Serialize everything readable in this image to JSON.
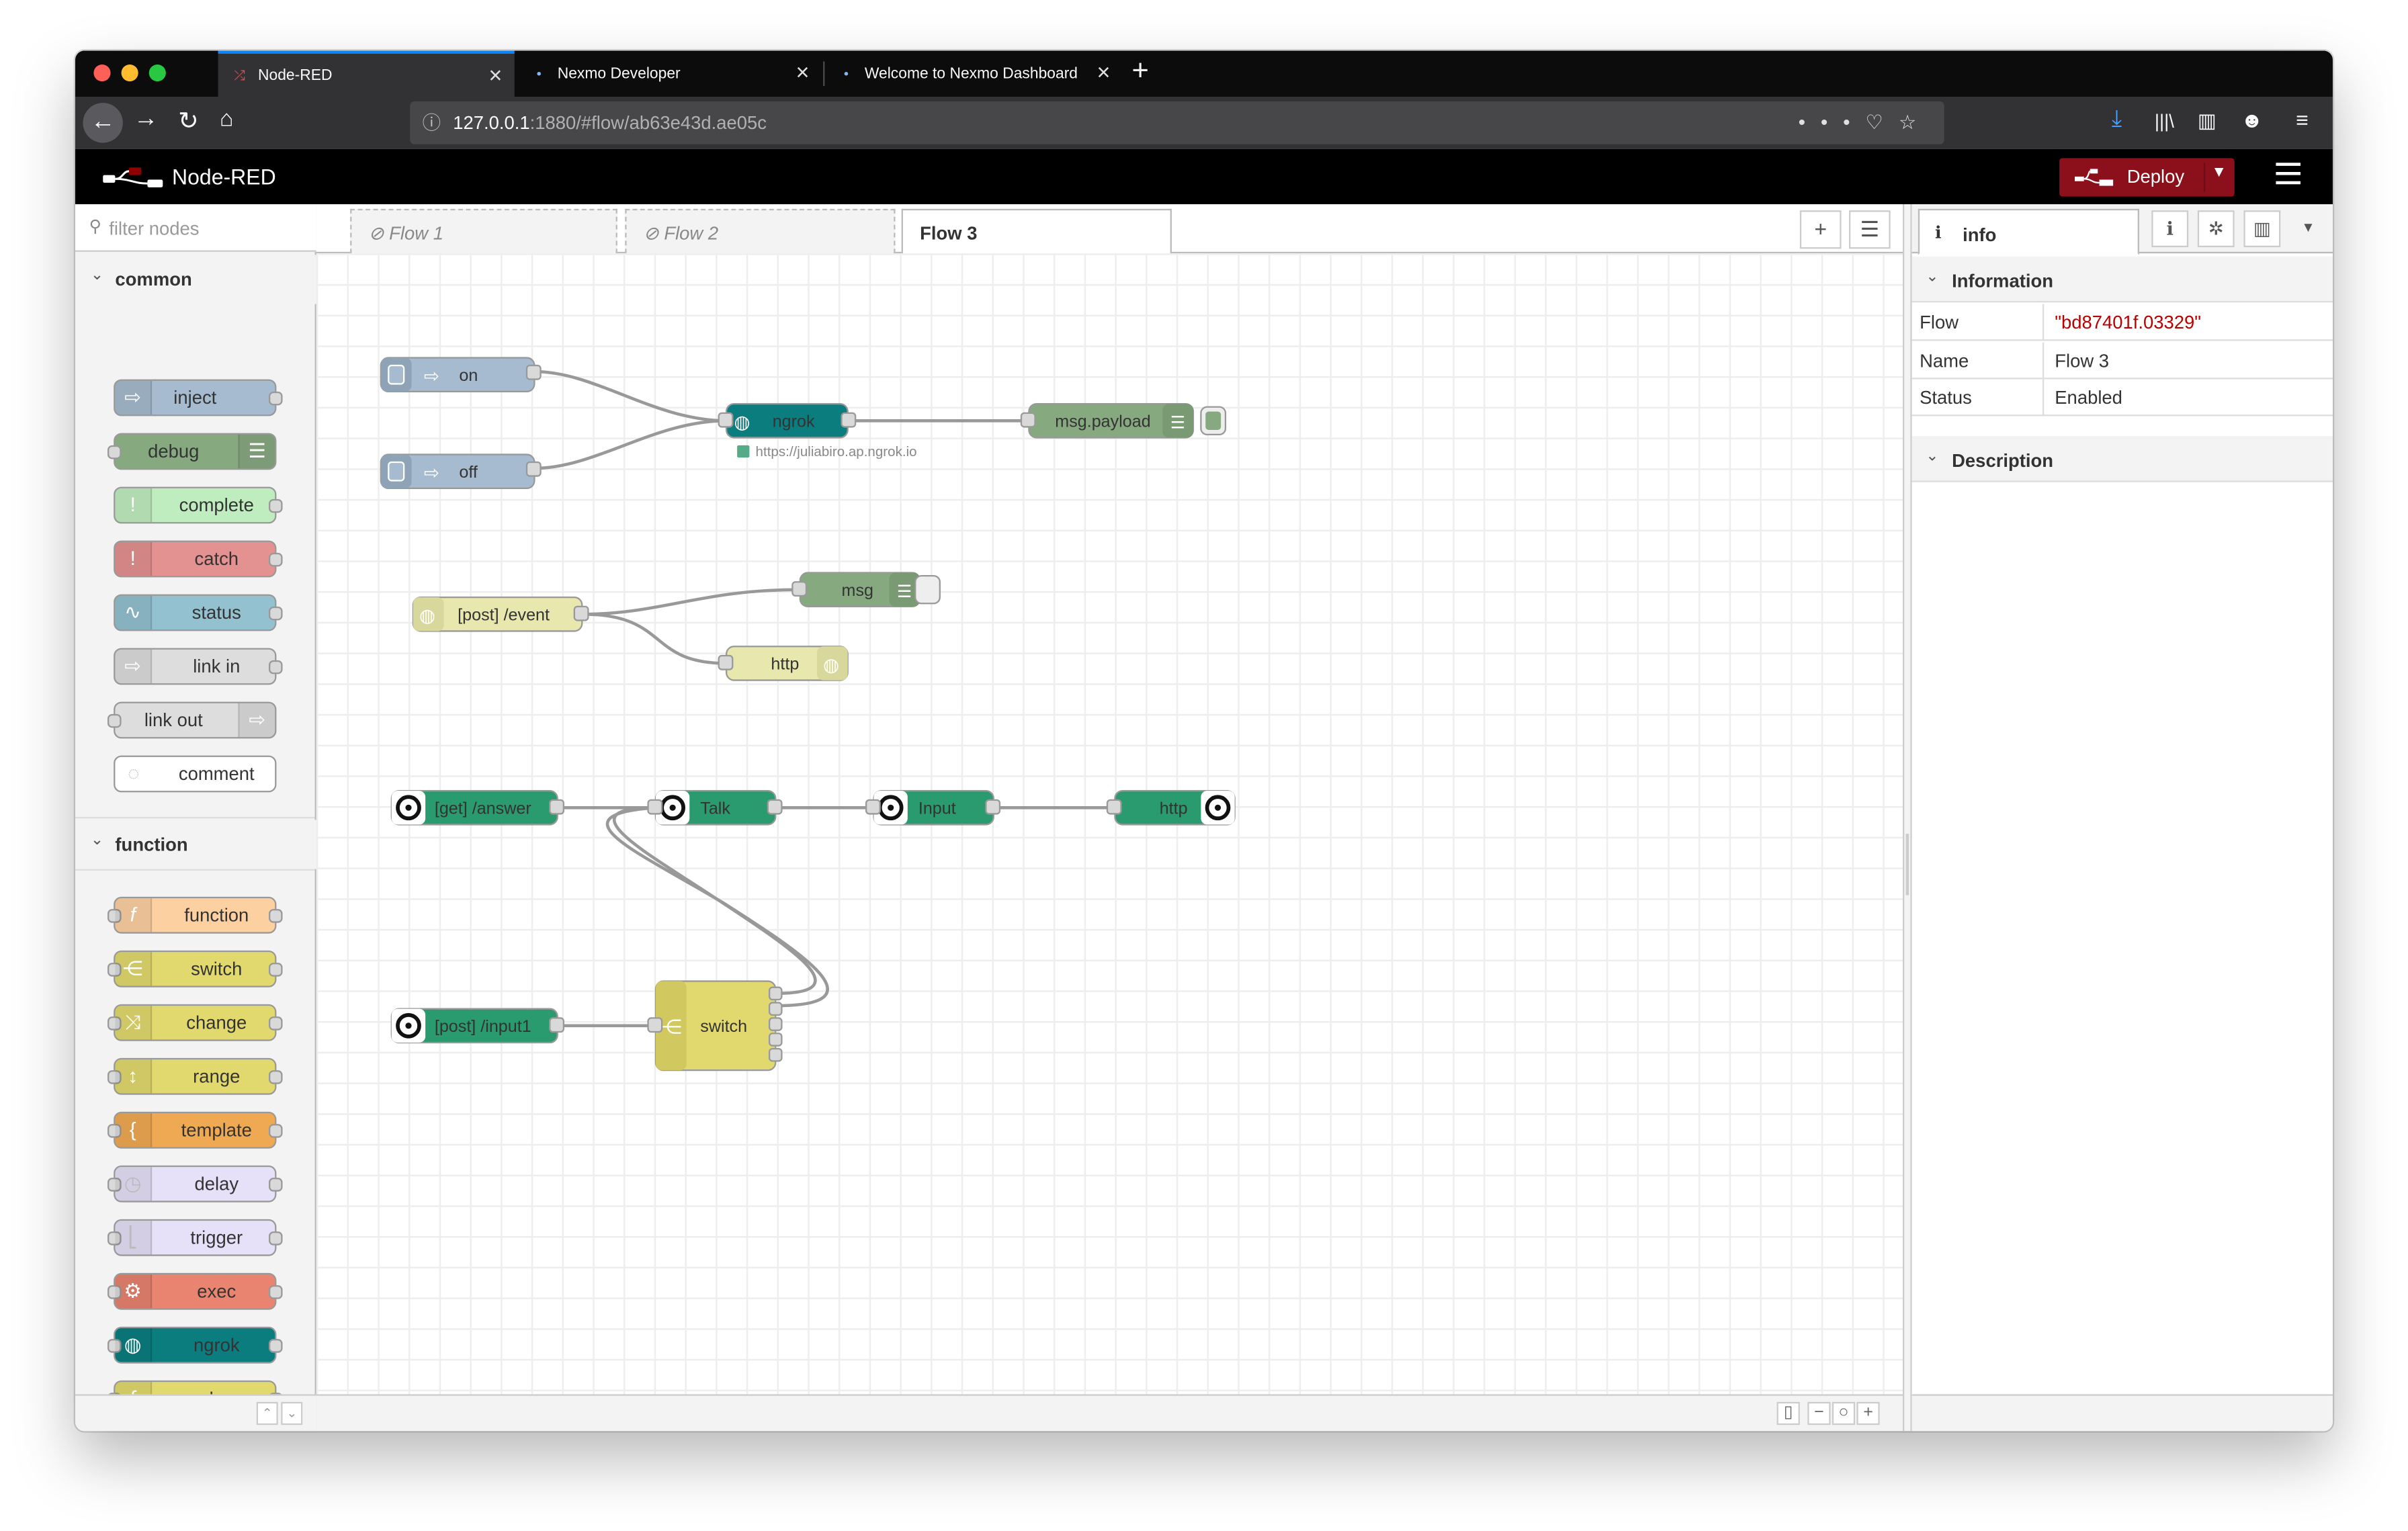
{
  "browser": {
    "tabs": [
      {
        "title": "Node-RED",
        "active": true
      },
      {
        "title": "Nexmo Developer",
        "active": false
      },
      {
        "title": "Welcome to Nexmo Dashboard",
        "active": false
      }
    ],
    "url_host": "127.0.0.1",
    "url_rest": ":1880/#flow/ab63e43d.ae05c"
  },
  "app": {
    "title": "Node-RED",
    "deploy_label": "Deploy"
  },
  "palette": {
    "filter_placeholder": "filter nodes",
    "categories": [
      {
        "name": "common",
        "nodes": [
          "inject",
          "debug",
          "complete",
          "catch",
          "status",
          "link in",
          "link out",
          "comment"
        ]
      },
      {
        "name": "function",
        "nodes": [
          "function",
          "switch",
          "change",
          "range",
          "template",
          "delay",
          "trigger",
          "exec",
          "ngrok",
          "rbe"
        ]
      }
    ]
  },
  "workspace": {
    "tabs": [
      {
        "label": "Flow 1",
        "disabled": true
      },
      {
        "label": "Flow 2",
        "disabled": true
      },
      {
        "label": "Flow 3",
        "disabled": false
      }
    ],
    "nodes": {
      "on": "on",
      "off": "off",
      "ngrok": "ngrok",
      "ngrok_status": "https://juliabiro.ap.ngrok.io",
      "msg_payload": "msg.payload",
      "post_event": "[post] /event",
      "msg": "msg",
      "http_resp": "http",
      "get_answer": "[get] /answer",
      "talk": "Talk",
      "input": "Input",
      "http_out": "http",
      "post_input": "[post] /input1",
      "switch": "switch"
    }
  },
  "sidebar": {
    "tab_label": "info",
    "information_header": "Information",
    "description_header": "Description",
    "properties": [
      {
        "key": "Flow",
        "value": "\"bd87401f.03329\""
      },
      {
        "key": "Name",
        "value": "Flow 3"
      },
      {
        "key": "Status",
        "value": "Enabled"
      }
    ]
  },
  "colors": {
    "inject": "#a6bbcf",
    "debug": "#87a980",
    "complete": "#c0edc0",
    "catch": "#e49191",
    "status": "#94c1d0",
    "link": "#dddddd",
    "function": "#fdd0a2",
    "switch": "#e2d96e",
    "change": "#e2d96e",
    "range": "#e2d96e",
    "template": "#f0a953",
    "delay": "#e6e0f8",
    "trigger": "#e6e0f8",
    "exec": "#e8846f",
    "ngrok": "#0b7d7f",
    "rbe": "#e2d96e",
    "http": "#e7e7ae",
    "nexmo": "#2a9a6f",
    "deploy": "#8c101c"
  }
}
